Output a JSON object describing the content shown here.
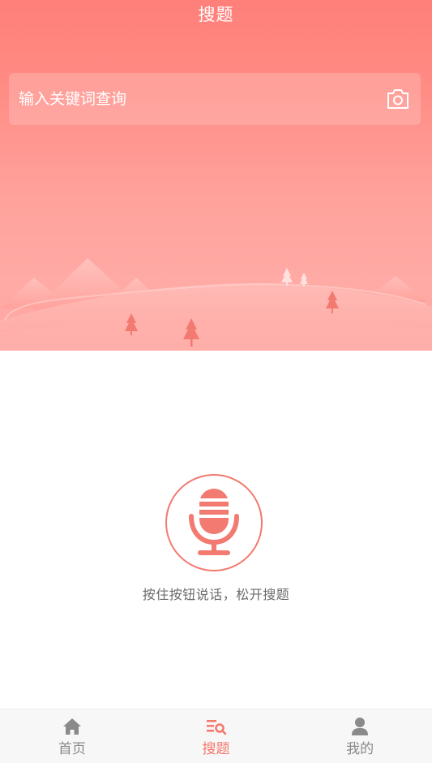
{
  "header": {
    "title": "搜题"
  },
  "search": {
    "placeholder": "输入关键词查询",
    "camera_icon": "camera-icon"
  },
  "voice": {
    "hint": "按住按钮说话，松开搜题",
    "mic_icon": "microphone-icon"
  },
  "tabbar": {
    "items": [
      {
        "label": "首页",
        "icon": "home-icon",
        "active": false
      },
      {
        "label": "搜题",
        "icon": "search-list-icon",
        "active": true
      },
      {
        "label": "我的",
        "icon": "user-icon",
        "active": false
      }
    ]
  },
  "colors": {
    "accent": "#f4776c",
    "hero_top": "#ff7f79",
    "hero_bottom": "#ffa7a2",
    "inactive": "#8a8a8a"
  }
}
